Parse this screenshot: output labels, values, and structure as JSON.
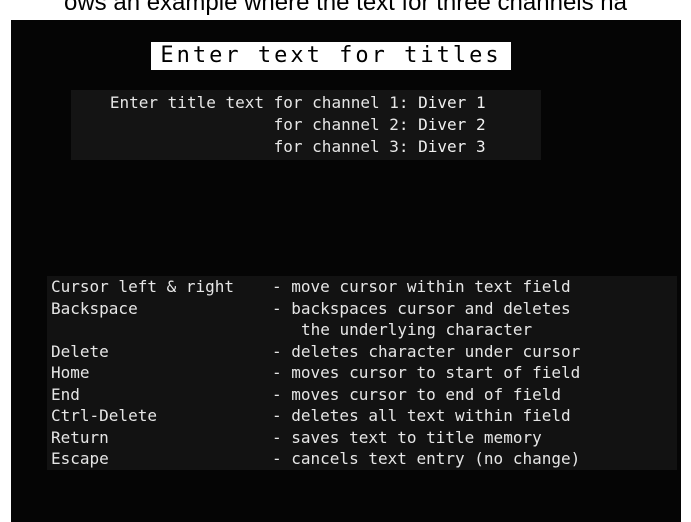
{
  "caption": "ows an example where the text for three channels ha",
  "screen": {
    "title": "Enter text for titles",
    "prompt": {
      "lead": "Enter title text",
      "channels": [
        {
          "prefix": "for channel 1:",
          "value": "Diver 1"
        },
        {
          "prefix": "for channel 2:",
          "value": "Diver 2"
        },
        {
          "prefix": "for channel 3:",
          "value": "Diver 3"
        }
      ]
    },
    "help": [
      {
        "key": "Cursor left & right",
        "desc": "- move cursor within text field"
      },
      {
        "key": "Backspace",
        "desc": "- backspaces cursor and deletes"
      },
      {
        "key": "",
        "desc": "the underlying character"
      },
      {
        "key": "Delete",
        "desc": "- deletes character under cursor"
      },
      {
        "key": "Home",
        "desc": "- moves cursor to start of field"
      },
      {
        "key": "End",
        "desc": "- moves cursor to end of field"
      },
      {
        "key": "Ctrl-Delete",
        "desc": "- deletes all text within field"
      },
      {
        "key": "Return",
        "desc": "- saves text to title memory"
      },
      {
        "key": "Escape",
        "desc": "- cancels text entry (no change)"
      }
    ]
  }
}
